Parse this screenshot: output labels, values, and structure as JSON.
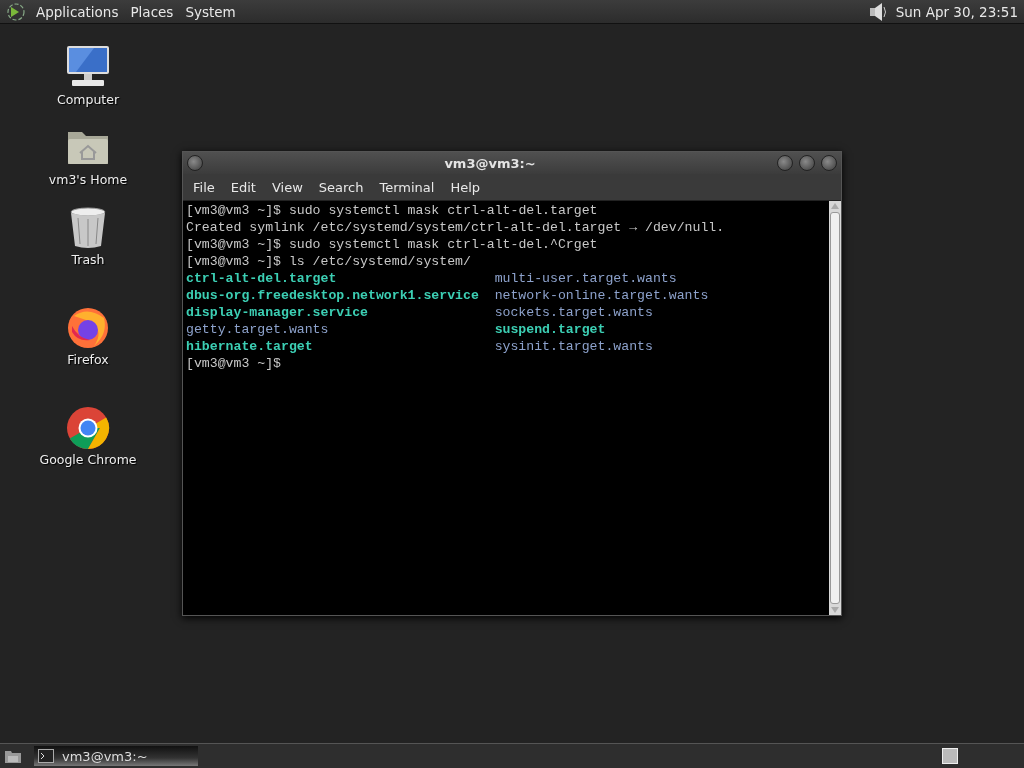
{
  "top_panel": {
    "menus": [
      "Applications",
      "Places",
      "System"
    ],
    "clock": "Sun Apr 30, 23:51"
  },
  "desktop_icons": [
    {
      "kind": "computer",
      "label": "Computer"
    },
    {
      "kind": "home",
      "label": "vm3's Home"
    },
    {
      "kind": "trash",
      "label": "Trash"
    },
    {
      "kind": "firefox",
      "label": "Firefox"
    },
    {
      "kind": "chrome",
      "label": "Google Chrome"
    }
  ],
  "terminal_window": {
    "title": "vm3@vm3:~",
    "menu": [
      "File",
      "Edit",
      "View",
      "Search",
      "Terminal",
      "Help"
    ],
    "lines_before": [
      "[vm3@vm3 ~]$ sudo systemctl mask ctrl-alt-del.target",
      "Created symlink /etc/systemd/system/ctrl-alt-del.target → /dev/null.",
      "[vm3@vm3 ~]$ sudo systemctl mask ctrl-alt-del.^Crget",
      "[vm3@vm3 ~]$ ls /etc/systemd/system/"
    ],
    "listing": [
      {
        "text": "ctrl-alt-del.target",
        "kind": "file"
      },
      {
        "text": "multi-user.target.wants",
        "kind": "dir"
      },
      {
        "text": "dbus-org.freedesktop.network1.service",
        "kind": "file"
      },
      {
        "text": "network-online.target.wants",
        "kind": "dir"
      },
      {
        "text": "display-manager.service",
        "kind": "file"
      },
      {
        "text": "sockets.target.wants",
        "kind": "dir"
      },
      {
        "text": "getty.target.wants",
        "kind": "dir"
      },
      {
        "text": "suspend.target",
        "kind": "file"
      },
      {
        "text": "hibernate.target",
        "kind": "file"
      },
      {
        "text": "sysinit.target.wants",
        "kind": "dir"
      }
    ],
    "lines_after": [
      "[vm3@vm3 ~]$"
    ]
  },
  "taskbar": {
    "tasks": [
      {
        "label": "vm3@vm3:~",
        "selected": true
      }
    ]
  }
}
